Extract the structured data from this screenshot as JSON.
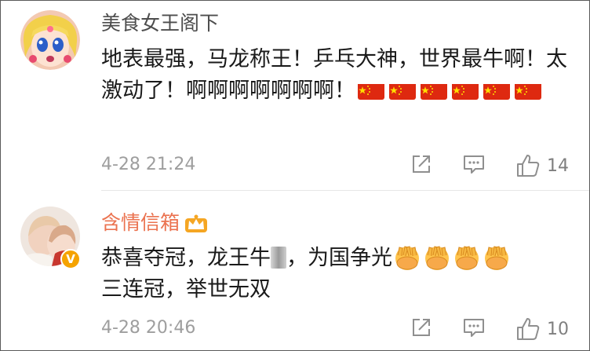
{
  "comments": [
    {
      "username": "美食女王阁下",
      "text": "地表最强，马龙称王！乒乓大神，世界最牛啊！太激动了！啊啊啊啊啊啊啊！",
      "emoji_icon": "china-flag-icon",
      "emoji_count": 6,
      "timestamp": "4-28 21:24",
      "like_count": "14"
    },
    {
      "username": "含情信箱",
      "vip_icon": "crown-icon",
      "verified_badge": "V",
      "text_part1": "恭喜夺冠，龙王牛",
      "text_part2": "，为国争光",
      "text_line2": "三连冠，举世无双",
      "emoji_icon": "peace-hands-icon",
      "emoji_count": 4,
      "timestamp": "4-28 20:46",
      "like_count": "10"
    }
  ],
  "colors": {
    "username_default": "#4d4d4d",
    "username_vip": "#eb7350",
    "meta_gray": "#9e9e9e",
    "badge_orange": "#f5a300",
    "flag_red": "#de2910",
    "flag_yellow": "#ffde00"
  }
}
